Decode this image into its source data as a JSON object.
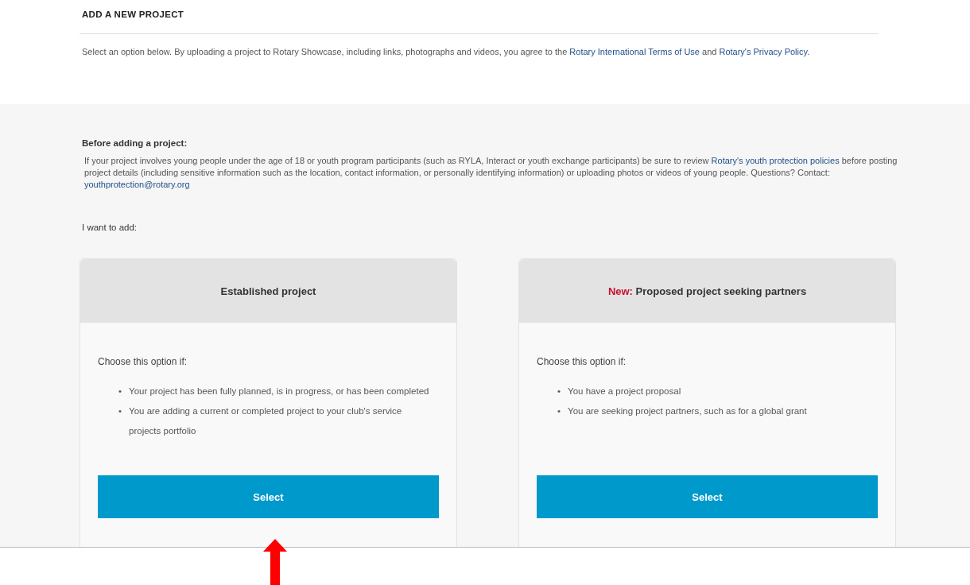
{
  "header": {
    "title": "ADD A NEW PROJECT",
    "intro": [
      {
        "kind": "text",
        "text": "Select an option below. By uploading a project to Rotary Showcase, including links, photographs and videos, you agree to the "
      },
      {
        "kind": "link",
        "text": "Rotary International Terms of Use"
      },
      {
        "kind": "text",
        "text": " and "
      },
      {
        "kind": "link",
        "text": "Rotary's Privacy Policy"
      },
      {
        "kind": "text",
        "text": "."
      }
    ]
  },
  "notice": {
    "heading": "Before adding a project:",
    "body": [
      {
        "kind": "text",
        "text": "If your project involves young people under the age of 18 or youth program participants (such as RYLA, Interact or youth exchange participants) be sure to review "
      },
      {
        "kind": "link",
        "text": "Rotary's youth protection policies"
      },
      {
        "kind": "text",
        "text": " before posting project details (including sensitive information such as the location, contact information, or personally identifying information) or uploading photos or videos of young people. Questions? Contact: "
      },
      {
        "kind": "link",
        "text": "youthprotection@rotary.org"
      }
    ]
  },
  "options_label": "I want to add:",
  "options": [
    {
      "title": [
        {
          "kind": "text",
          "text": "Established project"
        }
      ],
      "lead": "Choose this option if:",
      "points": [
        {
          "marker": "•",
          "text": "Your project has been fully planned, is in progress, or has been completed"
        },
        {
          "marker": "•",
          "text": "You are adding a current or completed project to your club's service projects portfolio"
        }
      ],
      "button": "Select"
    },
    {
      "title": [
        {
          "kind": "highlight",
          "text": "New:"
        },
        {
          "kind": "text",
          "text": " Proposed project seeking partners"
        }
      ],
      "lead": "Choose this option if:",
      "points": [
        {
          "marker": "•",
          "text": "You have a project proposal"
        },
        {
          "marker": "•",
          "text": "You are seeking project partners, such as for a global grant"
        }
      ],
      "button": "Select"
    }
  ]
}
